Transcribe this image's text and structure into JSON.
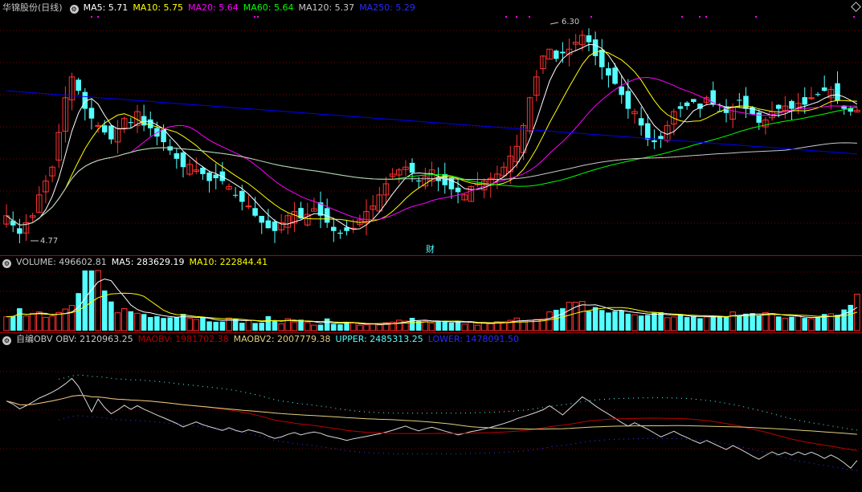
{
  "main": {
    "stock_name": "华锦股份(日线)",
    "ma5": "MA5: 5.71",
    "ma10": "MA10: 5.75",
    "ma20": "MA20: 5.64",
    "ma60": "MA60: 5.64",
    "ma120": "MA120: 5.37",
    "ma250": "MA250: 5.29",
    "high_label": "6.30",
    "low_label": "4.77",
    "cai_marker": "财",
    "colors": {
      "ma5": "#ffffff",
      "ma10": "#ffff00",
      "ma20": "#ff00ff",
      "ma60": "#00ff00",
      "ma120": "#c8c8c8",
      "ma250": "#0000ff",
      "up": "#ff3232",
      "down": "#54ffff"
    }
  },
  "volume": {
    "volume": "VOLUME: 496602.81",
    "ma5": "MA5: 283629.19",
    "ma10": "MA10: 222844.41"
  },
  "obv": {
    "name": "自编OBV",
    "obv": "OBV: 2120963.25",
    "maobv": "MAOBV: 1981702.38",
    "maobv2": "MAOBV2: 2007779.38",
    "upper": "UPPER: 2485313.25",
    "lower": "LOWER: 1478091.50"
  },
  "chart_data": [
    {
      "type": "candlestick",
      "title": "华锦股份(日线)",
      "x": [
        1,
        2,
        3,
        4,
        5,
        6,
        7,
        8,
        9,
        10,
        11,
        12,
        13,
        14,
        15,
        16,
        17,
        18,
        19,
        20,
        21,
        22,
        23,
        24,
        25,
        26,
        27,
        28,
        29,
        30,
        31,
        32,
        33,
        34,
        35,
        36,
        37,
        38,
        39,
        40,
        41,
        42,
        43,
        44,
        45,
        46,
        47,
        48,
        49,
        50,
        51,
        52,
        53,
        54,
        55,
        56,
        57,
        58,
        59,
        60,
        61,
        62,
        63,
        64,
        65,
        66,
        67,
        68,
        69,
        70,
        71,
        72,
        73,
        74,
        75,
        76,
        77,
        78,
        79,
        80,
        81,
        82,
        83,
        84,
        85,
        86,
        87,
        88,
        89,
        90,
        91,
        92,
        93,
        94,
        95,
        96,
        97,
        98,
        99,
        100,
        101,
        102,
        103,
        104,
        105,
        106,
        107,
        108,
        109,
        110,
        111,
        112,
        113,
        114,
        115,
        116,
        117,
        118,
        119,
        120,
        121,
        122,
        123,
        124,
        125,
        126,
        127,
        128,
        129,
        130,
        131,
        132,
        133,
        134,
        135,
        136,
        137,
        138,
        139,
        140,
        141,
        142,
        143,
        144,
        145,
        146,
        147,
        148,
        149,
        150,
        151,
        152,
        153,
        154,
        155,
        156,
        157,
        158,
        159,
        160,
        161,
        162,
        163,
        164,
        165,
        166,
        167,
        168,
        169,
        170,
        171,
        172,
        173,
        174,
        175,
        176,
        177,
        178
      ],
      "close": [
        4.95,
        4.88,
        4.82,
        4.9,
        4.95,
        5.1,
        5.2,
        5.3,
        5.55,
        5.8,
        5.95,
        5.85,
        5.72,
        5.65,
        5.6,
        5.55,
        5.5,
        5.58,
        5.65,
        5.62,
        5.7,
        5.6,
        5.58,
        5.52,
        5.48,
        5.42,
        5.36,
        5.3,
        5.32,
        5.28,
        5.25,
        5.2,
        5.22,
        5.2,
        5.16,
        5.1,
        5.05,
        5.02,
        4.95,
        4.9,
        4.86,
        4.84,
        4.9,
        4.95,
        4.98,
        4.93,
        4.96,
        5.0,
        4.95,
        4.9,
        4.84,
        4.82,
        4.84,
        4.86,
        4.92,
        4.98,
        5.02,
        5.1,
        5.18,
        5.25,
        5.28,
        5.3,
        5.26,
        5.2,
        5.23,
        5.28,
        5.2,
        5.17,
        5.14,
        5.12,
        5.1,
        5.16,
        5.18,
        5.2,
        5.22,
        5.25,
        5.3,
        5.38,
        5.45,
        5.6,
        5.8,
        5.95,
        6.1,
        6.15,
        6.08,
        6.12,
        6.15,
        6.2,
        6.25,
        6.2,
        6.1,
        6.02,
        5.96,
        5.9,
        5.82,
        5.72,
        5.7,
        5.6,
        5.5,
        5.48,
        5.5,
        5.6,
        5.7,
        5.72,
        5.74,
        5.77,
        5.72,
        5.8,
        5.75,
        5.7,
        5.69,
        5.73,
        5.78,
        5.72,
        5.68,
        5.62,
        5.64,
        5.7,
        5.72,
        5.74,
        5.72,
        5.76,
        5.75,
        5.8,
        5.82,
        5.85,
        5.86,
        5.78,
        5.72,
        5.7,
        5.71
      ],
      "ylim": [
        4.7,
        6.4
      ],
      "annotations": [
        "6.30",
        "4.77",
        "财"
      ]
    },
    {
      "type": "bar",
      "title": "VOLUME",
      "values": [
        0.3,
        0.35,
        0.25,
        0.28,
        0.22,
        0.32,
        0.34,
        0.55,
        0.98,
        0.98,
        0.58,
        0.38,
        0.33,
        0.3,
        0.27,
        0.24,
        0.26,
        0.28,
        0.3,
        0.22,
        0.2,
        0.19,
        0.2,
        0.18,
        0.17,
        0.15,
        0.14,
        0.2,
        0.15,
        0.16,
        0.17,
        0.14,
        0.12,
        0.18,
        0.1,
        0.12,
        0.11,
        0.1,
        0.12,
        0.11,
        0.12,
        0.16,
        0.18,
        0.14,
        0.11,
        0.12,
        0.15,
        0.14,
        0.12,
        0.11,
        0.11,
        0.13,
        0.15,
        0.18,
        0.2,
        0.22,
        0.25,
        0.3,
        0.35,
        0.4,
        0.42,
        0.38,
        0.35,
        0.32,
        0.3,
        0.28,
        0.25,
        0.3,
        0.27,
        0.24,
        0.26,
        0.22,
        0.2,
        0.25,
        0.23,
        0.22,
        0.3,
        0.33,
        0.36,
        0.28,
        0.24,
        0.22,
        0.25,
        0.26,
        0.24,
        0.28,
        0.3,
        0.33,
        0.45,
        0.62
      ],
      "series": [
        {
          "name": "VOLUME",
          "values": []
        },
        {
          "name": "MA5",
          "values": []
        },
        {
          "name": "MA10",
          "values": []
        }
      ]
    },
    {
      "type": "line",
      "title": "自编OBV",
      "series": [
        {
          "name": "OBV"
        },
        {
          "name": "MAOBV"
        },
        {
          "name": "MAOBV2"
        },
        {
          "name": "UPPER"
        },
        {
          "name": "LOWER"
        }
      ]
    }
  ]
}
